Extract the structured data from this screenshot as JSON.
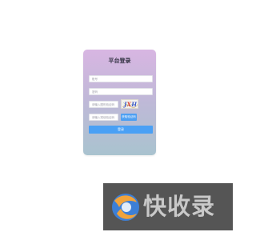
{
  "login": {
    "title": "平台登录",
    "account_placeholder": "账号",
    "password_placeholder": "密码",
    "captcha_placeholder": "请输入图形验证码",
    "captcha_text": "JXH",
    "sms_placeholder": "请输入短信验证码",
    "sms_button_label": "获取验证码",
    "login_button_label": "登录"
  },
  "watermark": {
    "text": "快收录"
  },
  "colors": {
    "card_top": "#d8b6e2",
    "card_bottom": "#a9c3cf",
    "accent": "#4aa0f5",
    "captcha_red": "#d8453a",
    "captcha_blue": "#3a58c8"
  }
}
